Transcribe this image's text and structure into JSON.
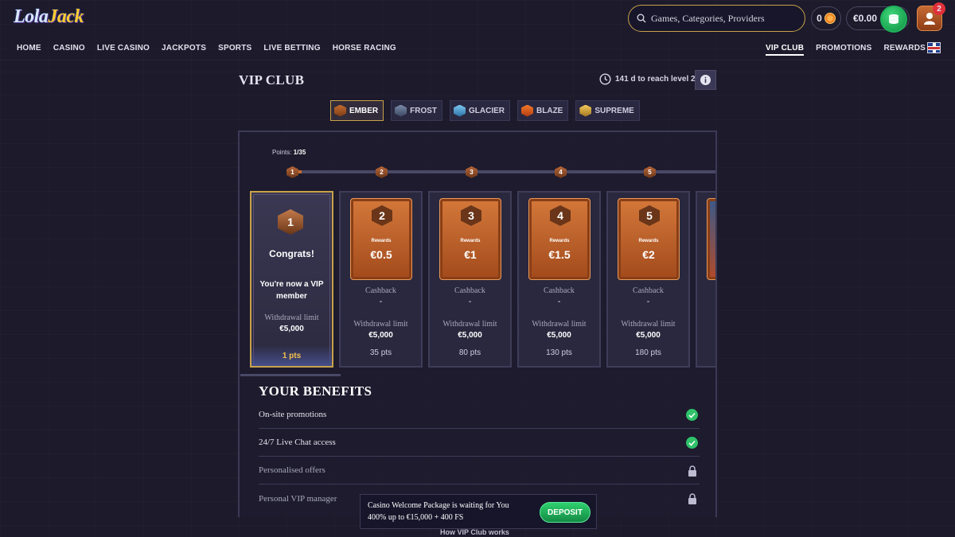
{
  "header": {
    "logo_lola": "Lola",
    "logo_jack": "Jack",
    "search_placeholder": "Games, Categories, Providers",
    "coins": "0",
    "balance": "€0.00",
    "notifications": "2",
    "nav_left": [
      "HOME",
      "CASINO",
      "LIVE CASINO",
      "JACKPOTS",
      "SPORTS",
      "LIVE BETTING",
      "HORSE RACING"
    ],
    "nav_right": [
      "VIP CLUB",
      "PROMOTIONS",
      "REWARDS"
    ]
  },
  "vip": {
    "title": "VIP CLUB",
    "level_info": "141 d to reach level 2",
    "tiers": [
      "EMBER",
      "FROST",
      "GLACIER",
      "BLAZE",
      "SUPREME"
    ],
    "active_tier": "EMBER",
    "points_label": "Points:",
    "points_value": "1/35",
    "steps": [
      "1",
      "2",
      "3",
      "4",
      "5"
    ],
    "current": {
      "level": "1",
      "congrats": "Congrats!",
      "message": "You're now a VIP member",
      "withdrawal_label": "Withdrawal limit",
      "withdrawal_value": "€5,000",
      "pts": "1 pts"
    },
    "levels": [
      {
        "level": "2",
        "rewards_label": "Rewards",
        "reward": "€0.5",
        "cashback_label": "Cashback",
        "cashback": "-",
        "withdrawal_label": "Withdrawal limit",
        "withdrawal_value": "€5,000",
        "pts": "35 pts"
      },
      {
        "level": "3",
        "rewards_label": "Rewards",
        "reward": "€1",
        "cashback_label": "Cashback",
        "cashback": "-",
        "withdrawal_label": "Withdrawal limit",
        "withdrawal_value": "€5,000",
        "pts": "80 pts"
      },
      {
        "level": "4",
        "rewards_label": "Rewards",
        "reward": "€1.5",
        "cashback_label": "Cashback",
        "cashback": "-",
        "withdrawal_label": "Withdrawal limit",
        "withdrawal_value": "€5,000",
        "pts": "130 pts"
      },
      {
        "level": "5",
        "rewards_label": "Rewards",
        "reward": "€2",
        "cashback_label": "Cashback",
        "cashback": "-",
        "withdrawal_label": "Withdrawal limit",
        "withdrawal_value": "€5,000",
        "pts": "180 pts"
      }
    ]
  },
  "benefits": {
    "title": "YOUR BENEFITS",
    "items": [
      {
        "label": "On-site promotions",
        "status": "unlocked"
      },
      {
        "label": "24/7 Live Chat access",
        "status": "unlocked"
      },
      {
        "label": "Personalised offers",
        "status": "locked"
      },
      {
        "label": "Personal VIP manager",
        "status": "locked"
      }
    ]
  },
  "promo": {
    "title": "Casino Welcome Package is waiting for You",
    "offer": "400% up to €15,000 + 400 FS",
    "button": "DEPOSIT"
  },
  "footer": {
    "how_link": "How VIP Club works"
  },
  "colors": {
    "accent_gold": "#c8a24a",
    "ember": "#c46c2f",
    "success": "#2fc26a"
  }
}
